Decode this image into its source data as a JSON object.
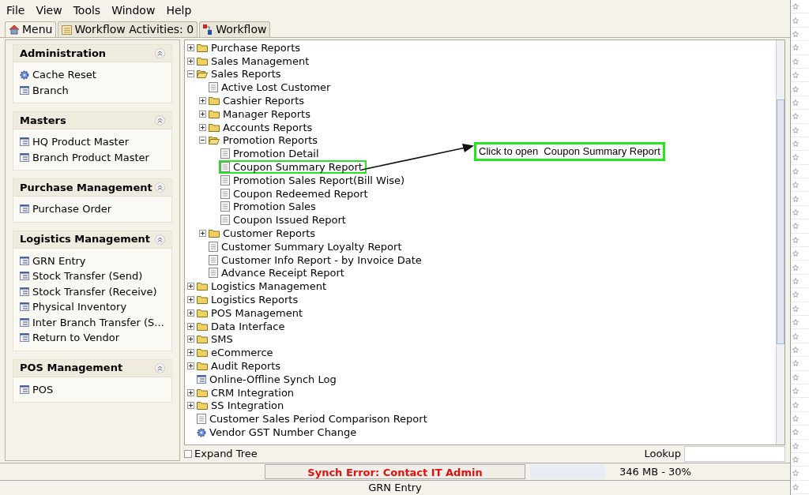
{
  "menu_bar": [
    "File",
    "View",
    "Tools",
    "Window",
    "Help"
  ],
  "tabs": [
    {
      "label": "Menu",
      "kind": "home",
      "selected": true
    },
    {
      "label": "Workflow Activities: 0",
      "kind": "list",
      "selected": false
    },
    {
      "label": "Workflow",
      "kind": "flow",
      "selected": false
    }
  ],
  "sidebar": [
    {
      "title": "Administration",
      "expanded": true,
      "items": [
        {
          "label": "Cache Reset",
          "kind": "gear"
        },
        {
          "label": "Branch",
          "kind": "form"
        }
      ]
    },
    {
      "title": "Masters",
      "expanded": true,
      "items": [
        {
          "label": "HQ Product Master",
          "kind": "form"
        },
        {
          "label": "Branch Product Master",
          "kind": "form"
        }
      ]
    },
    {
      "title": "Purchase Management",
      "expanded": true,
      "items": [
        {
          "label": "Purchase Order",
          "kind": "form"
        }
      ]
    },
    {
      "title": "Logistics Management",
      "expanded": true,
      "items": [
        {
          "label": "GRN Entry",
          "kind": "form"
        },
        {
          "label": "Stock Transfer (Send)",
          "kind": "form"
        },
        {
          "label": "Stock Transfer (Receive)",
          "kind": "form"
        },
        {
          "label": "Physical Inventory",
          "kind": "form"
        },
        {
          "label": "Inter Branch Transfer (S...",
          "kind": "form"
        },
        {
          "label": "Return to Vendor",
          "kind": "form"
        }
      ]
    },
    {
      "title": "POS Management",
      "expanded": true,
      "items": [
        {
          "label": "POS",
          "kind": "form"
        }
      ]
    }
  ],
  "tree": [
    {
      "label": "Purchase Reports",
      "kind": "folder",
      "expanded": false
    },
    {
      "label": "Sales Management",
      "kind": "folder",
      "expanded": false
    },
    {
      "label": "Sales Reports",
      "kind": "folder",
      "expanded": true,
      "children": [
        {
          "label": "Active Lost Customer",
          "kind": "report"
        },
        {
          "label": "Cashier Reports",
          "kind": "folder",
          "expanded": false
        },
        {
          "label": "Manager Reports",
          "kind": "folder",
          "expanded": false
        },
        {
          "label": "Accounts Reports",
          "kind": "folder",
          "expanded": false
        },
        {
          "label": "Promotion Reports",
          "kind": "folder",
          "expanded": true,
          "children": [
            {
              "label": "Promotion Detail",
              "kind": "report",
              "highlighted": false
            },
            {
              "label": "Coupon Summary Report",
              "kind": "report",
              "highlighted": true
            },
            {
              "label": "Promotion Sales Report(Bill Wise)",
              "kind": "report",
              "highlighted": false
            },
            {
              "label": "Coupon Redeemed Report",
              "kind": "report",
              "highlighted": false
            },
            {
              "label": "Promotion Sales",
              "kind": "report",
              "highlighted": false
            },
            {
              "label": "Coupon Issued Report",
              "kind": "report",
              "highlighted": false
            }
          ]
        },
        {
          "label": "Customer Reports",
          "kind": "folder",
          "expanded": false
        },
        {
          "label": "Customer Summary Loyalty Report",
          "kind": "report"
        },
        {
          "label": "Customer Info Report - by Invoice Date",
          "kind": "report"
        },
        {
          "label": "Advance Receipt Report",
          "kind": "report"
        }
      ]
    },
    {
      "label": "Logistics Management",
      "kind": "folder",
      "expanded": false
    },
    {
      "label": "Logistics Reports",
      "kind": "folder",
      "expanded": false
    },
    {
      "label": "POS Management",
      "kind": "folder",
      "expanded": false
    },
    {
      "label": "Data Interface",
      "kind": "folder",
      "expanded": false
    },
    {
      "label": "SMS",
      "kind": "folder",
      "expanded": false
    },
    {
      "label": "eCommerce",
      "kind": "folder",
      "expanded": false
    },
    {
      "label": "Audit Reports",
      "kind": "folder",
      "expanded": false
    },
    {
      "label": "Online-Offline Synch Log",
      "kind": "form"
    },
    {
      "label": "CRM Integration",
      "kind": "folder",
      "expanded": false
    },
    {
      "label": "SS Integration",
      "kind": "folder",
      "expanded": false
    },
    {
      "label": "Customer Sales Period Comparison Report",
      "kind": "report"
    },
    {
      "label": "Vendor GST Number Change",
      "kind": "gear"
    }
  ],
  "callout": "Click to open  Coupon Summary Report",
  "expand_tree": {
    "label": "Expand Tree",
    "checked": false
  },
  "lookup": {
    "label": "Lookup"
  },
  "status": {
    "error": "Synch Error: Contact IT Admin",
    "memory": "346 MB - 30%"
  },
  "footer": "GRN Entry"
}
